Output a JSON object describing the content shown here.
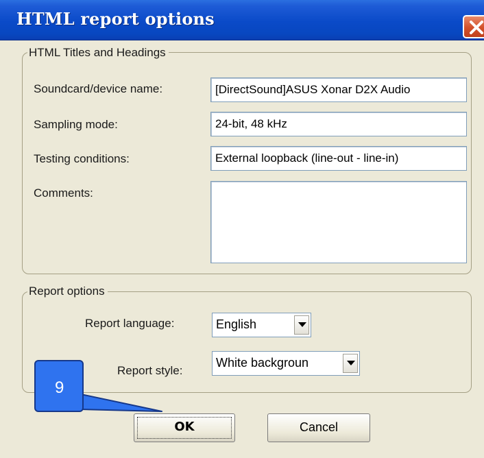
{
  "window": {
    "title": "HTML report options",
    "close_icon": "close-icon"
  },
  "titles_group": {
    "legend": "HTML Titles and Headings",
    "soundcard_label": "Soundcard/device name:",
    "soundcard_value": "[DirectSound]ASUS Xonar D2X Audio",
    "sampling_label": "Sampling mode:",
    "sampling_value": "24-bit, 48 kHz",
    "testing_label": "Testing conditions:",
    "testing_value": "External loopback (line-out - line-in)",
    "comments_label": "Comments:",
    "comments_value": ""
  },
  "report_group": {
    "legend": "Report options",
    "language_label": "Report language:",
    "language_value": "English",
    "style_label": "Report style:",
    "style_value": "White backgroun"
  },
  "buttons": {
    "ok_label": "OK",
    "cancel_label": "Cancel"
  },
  "callout": {
    "number": "9",
    "color": "#2f73ef"
  },
  "colors": {
    "titlebar": "#0a4ac8",
    "dialog_bg": "#ece9d8",
    "close_button": "#d3502a"
  }
}
